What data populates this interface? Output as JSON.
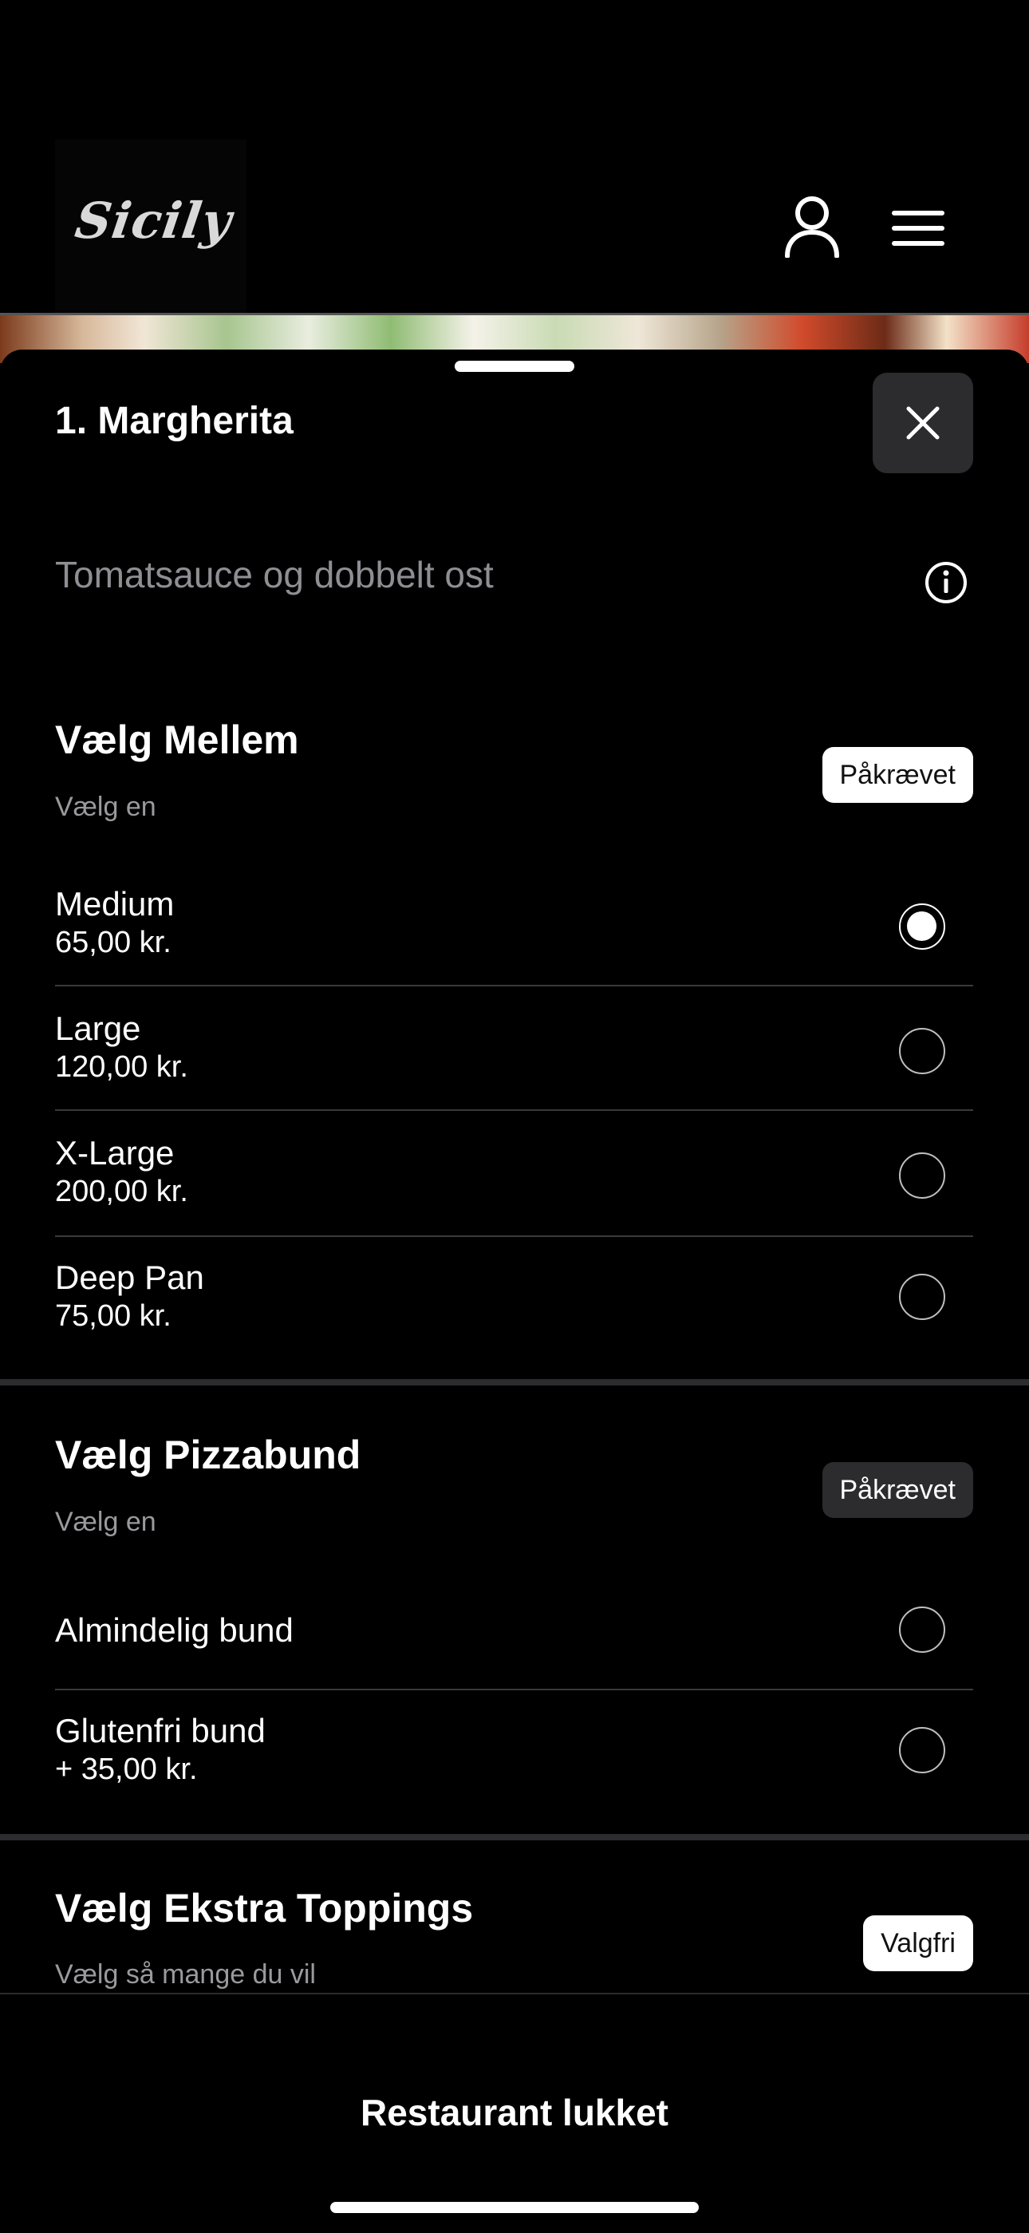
{
  "header": {
    "logo_text": "Sicily",
    "icons": [
      "user-icon",
      "menu-icon"
    ]
  },
  "product": {
    "title": "1. Margherita",
    "description": "Tomatsauce og dobbelt ost"
  },
  "sections": [
    {
      "title": "Vælg Mellem",
      "subtitle": "Vælg en",
      "badge": "Påkrævet",
      "options": [
        {
          "name": "Medium",
          "price": "65,00 kr.",
          "selected": true
        },
        {
          "name": "Large",
          "price": "120,00 kr.",
          "selected": false
        },
        {
          "name": "X-Large",
          "price": "200,00 kr.",
          "selected": false
        },
        {
          "name": "Deep Pan",
          "price": "75,00 kr.",
          "selected": false
        }
      ]
    },
    {
      "title": "Vælg Pizzabund",
      "subtitle": "Vælg en",
      "badge": "Påkrævet",
      "options": [
        {
          "name": "Almindelig bund",
          "price": "",
          "selected": false
        },
        {
          "name": "Glutenfri bund",
          "price": "+ 35,00 kr.",
          "selected": false
        }
      ]
    },
    {
      "title": "Vælg Ekstra Toppings",
      "subtitle": "Vælg så mange du vil",
      "badge": "Valgfri"
    }
  ],
  "footer": {
    "status": "Restaurant lukket"
  }
}
